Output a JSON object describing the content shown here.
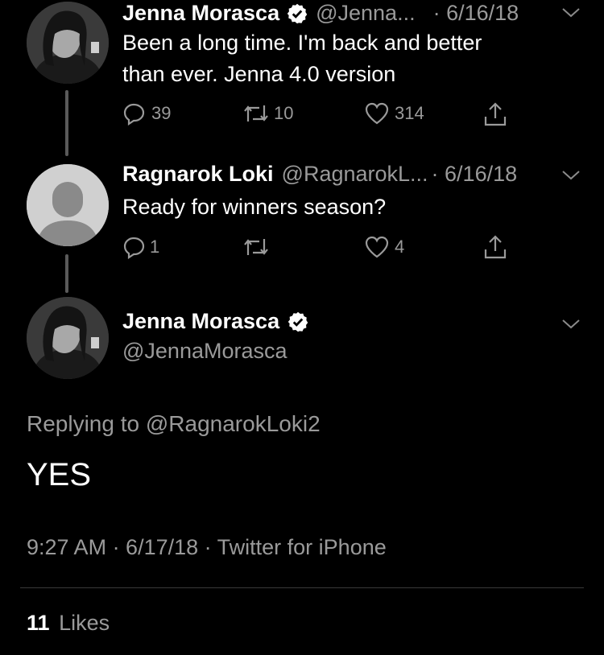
{
  "tweets": [
    {
      "name": "Jenna Morasca",
      "handle": "@Jenna...",
      "date": "· 6/16/18",
      "text_line1": "Been a long time. I'm back and better",
      "text_line2": "than ever. Jenna 4.0 version",
      "replies": "39",
      "retweets": "10",
      "likes": "314"
    },
    {
      "name": "Ragnarok Loki",
      "handle": "@RagnarokL...",
      "date": "· 6/16/18",
      "text_line1": "Ready for winners season?",
      "replies": "1",
      "retweets": "",
      "likes": "4"
    }
  ],
  "main": {
    "name": "Jenna Morasca",
    "handle": "@JennaMorasca",
    "replying_prefix": "Replying to ",
    "replying_to": "@RagnarokLoki2",
    "text": "YES",
    "meta": "9:27 AM · 6/17/18 · Twitter for iPhone",
    "likes_count": "11",
    "likes_label": "Likes"
  },
  "icons": {
    "verified": "verified-badge-icon",
    "reply": "reply-icon",
    "retweet": "retweet-icon",
    "like": "heart-icon",
    "share": "share-icon",
    "more": "chevron-down-icon"
  },
  "colors": {
    "background": "#000000",
    "primary_text": "#ffffff",
    "secondary_text": "#9a9a9a"
  }
}
